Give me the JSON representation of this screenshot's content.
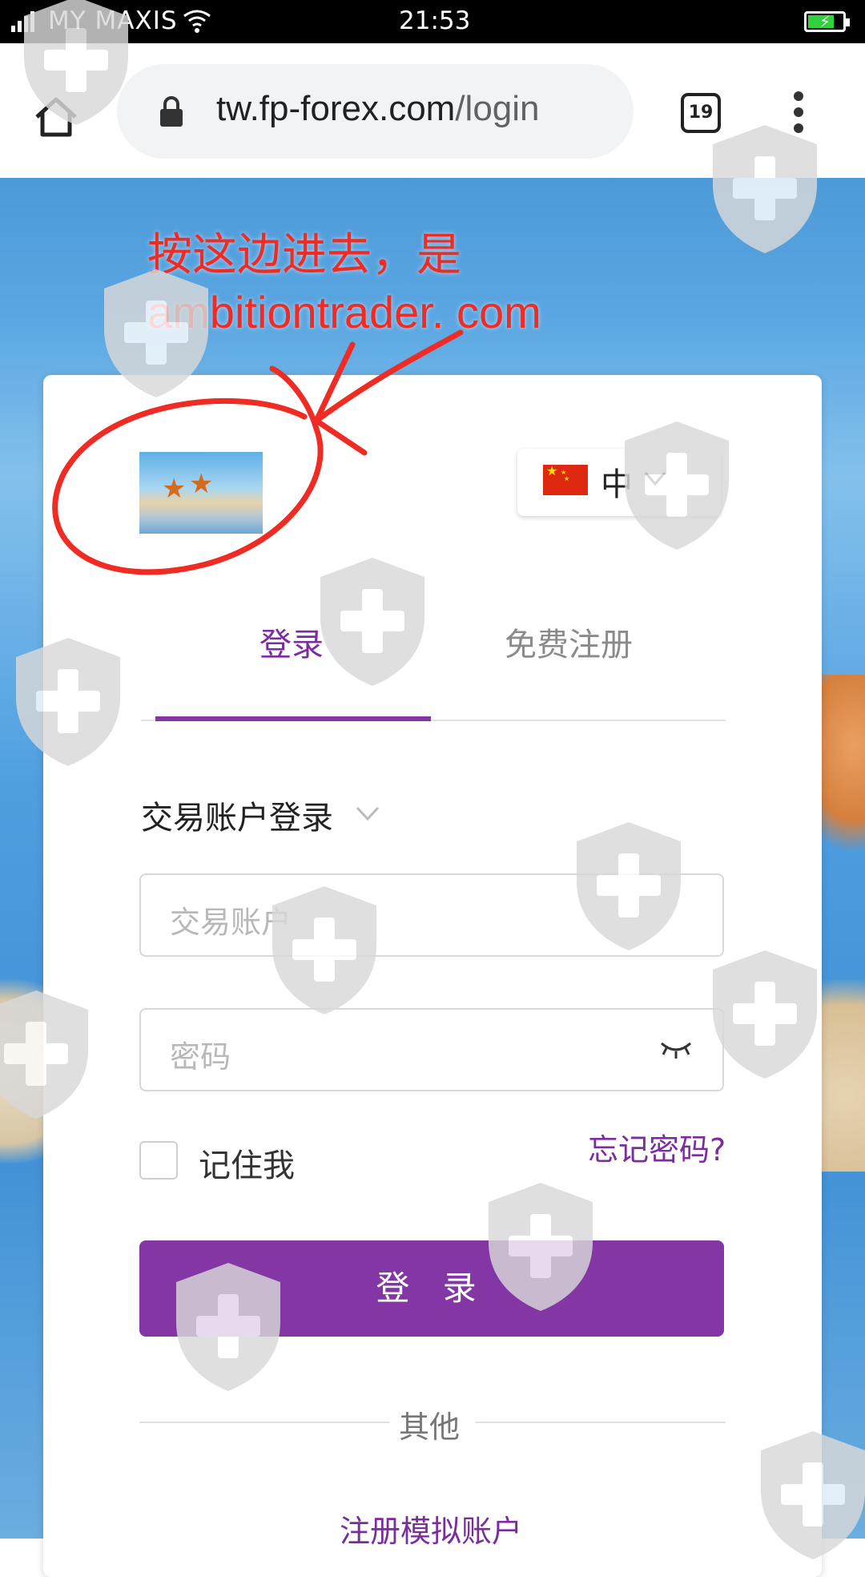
{
  "status_bar": {
    "carrier": "MY MAXIS",
    "time": "21:53",
    "battery_charging": true,
    "icons": [
      "signal-icon",
      "wifi-icon",
      "battery-icon"
    ]
  },
  "browser": {
    "url_host": "tw.fp-forex.com",
    "url_path": "/login",
    "tab_count": "19",
    "icons": [
      "home-icon",
      "lock-icon",
      "tabs-icon",
      "more-vert-icon"
    ]
  },
  "annotation": {
    "line1": "按这边进去，是",
    "line2": "ambitiontrader. com",
    "color": "#ef2b24"
  },
  "login": {
    "language_label": "中",
    "tabs": [
      {
        "label": "登录",
        "active": true
      },
      {
        "label": "免费注册",
        "active": false
      }
    ],
    "account_type": "交易账户登录",
    "account_placeholder": "交易账户",
    "password_placeholder": "密码",
    "remember_label": "记住我",
    "forgot_label": "忘记密码?",
    "login_button": "登 录",
    "other_label": "其他",
    "demo_link": "注册模拟账户"
  },
  "colors": {
    "accent": "#8436a5",
    "accent_text": "#7b2d9e",
    "annotation": "#ef2b24"
  }
}
